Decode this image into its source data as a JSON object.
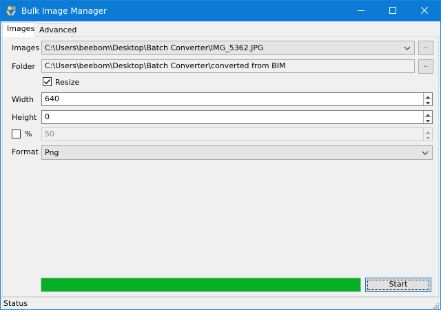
{
  "window": {
    "title": "Bulk Image Manager",
    "accent_color": "#0b7bd6"
  },
  "tabs": [
    {
      "label": "Images",
      "active": true
    },
    {
      "label": "Advanced",
      "active": false
    }
  ],
  "form": {
    "images_label": "Images",
    "images_value": "C:\\Users\\beebom\\Desktop\\Batch Converter\\IMG_5362.JPG",
    "images_browse": "..",
    "folder_label": "Folder",
    "folder_value": "C:\\Users\\beebom\\Desktop\\Batch Converter\\converted from BIM",
    "folder_browse": "..",
    "resize_label": "Resize",
    "resize_checked": true,
    "width_label": "Width",
    "width_value": "640",
    "height_label": "Height",
    "height_value": "0",
    "percent_label": "%",
    "percent_checked": false,
    "percent_value": "50",
    "format_label": "Format",
    "format_value": "Png"
  },
  "progress": {
    "fraction": 1.0,
    "fill_color": "#06b025"
  },
  "actions": {
    "start_label": "Start"
  },
  "status": {
    "text": "Status"
  },
  "icons": {
    "app": "tools-icon",
    "minimize": "minimize-icon",
    "maximize": "maximize-icon",
    "close": "close-icon",
    "dropdown": "chevron-down-icon",
    "check": "check-icon",
    "grip": "resize-grip-icon"
  }
}
